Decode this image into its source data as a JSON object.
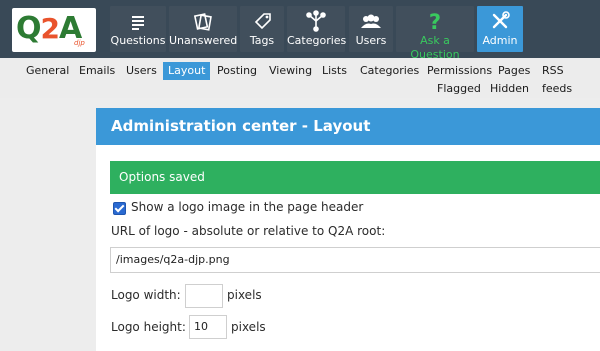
{
  "logo": {
    "main": "Q2A",
    "sub": "djp"
  },
  "nav": [
    {
      "label": "Questions",
      "icon": "questions-icon"
    },
    {
      "label": "Unanswered",
      "icon": "unanswered-icon"
    },
    {
      "label": "Tags",
      "icon": "tag-icon"
    },
    {
      "label": "Categories",
      "icon": "categories-icon"
    },
    {
      "label": "Users",
      "icon": "users-icon"
    },
    {
      "label": "Ask a Question",
      "icon": "question-mark-icon",
      "color": "#39c95e"
    },
    {
      "label": "Admin",
      "icon": "tools-icon",
      "active": true
    }
  ],
  "subnav": [
    {
      "label": "General"
    },
    {
      "label": "Emails"
    },
    {
      "label": "Users"
    },
    {
      "label": "Layout",
      "active": true
    },
    {
      "label": "Posting"
    },
    {
      "label": "Viewing"
    },
    {
      "label": "Lists"
    },
    {
      "label": "Categories"
    },
    {
      "label": "Permissions"
    },
    {
      "label": "Pages"
    },
    {
      "label": "RSS feeds"
    },
    {
      "label": "Flagged"
    },
    {
      "label": "Hidden"
    }
  ],
  "panel": {
    "title": "Administration center - Layout",
    "saved_message": "Options saved",
    "show_logo_label": "Show a logo image in the page header",
    "show_logo_checked": true,
    "logo_url_label": "URL of logo - absolute or relative to Q2A root:",
    "logo_url_value": "/images/q2a-djp.png",
    "logo_width_label": "Logo width:",
    "logo_width_value": "",
    "logo_width_unit": "pixels",
    "logo_height_label": "Logo height:",
    "logo_height_value": "10",
    "logo_height_unit": "pixels"
  },
  "colors": {
    "topbar": "#394957",
    "accent": "#3b98d8",
    "success": "#2eb05f",
    "ask": "#39c95e"
  }
}
